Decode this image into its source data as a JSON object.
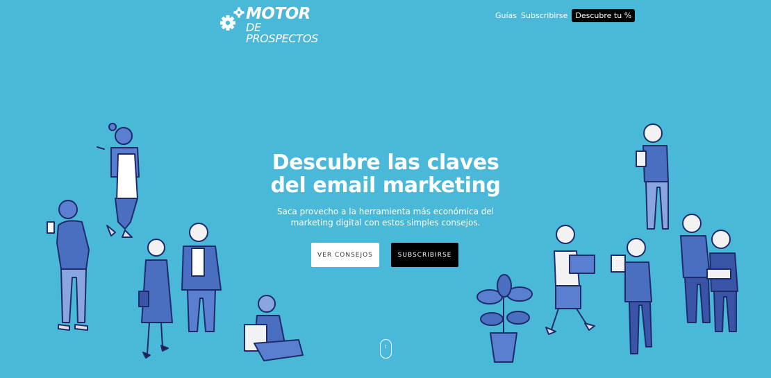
{
  "logo": {
    "line1": "MOTOR",
    "line2": "DE PROSPECTOS",
    "icon": "gears-icon"
  },
  "nav": {
    "link1": "Guías",
    "link2": "Subscribirse",
    "cta": "Descubre tu %"
  },
  "hero": {
    "title_line1": "Descubre las claves",
    "title_line2": "del email marketing",
    "subtitle_line1": "Saca provecho a la herramienta más económica del",
    "subtitle_line2": "marketing digital con estos simples consejos.",
    "btn_primary": "VER CONSEJOS",
    "btn_secondary": "SUBSCRIBIRSE"
  },
  "colors": {
    "background": "#4ab8d8",
    "illustration": "#5a7fd0",
    "outline": "#1f2a6a"
  }
}
